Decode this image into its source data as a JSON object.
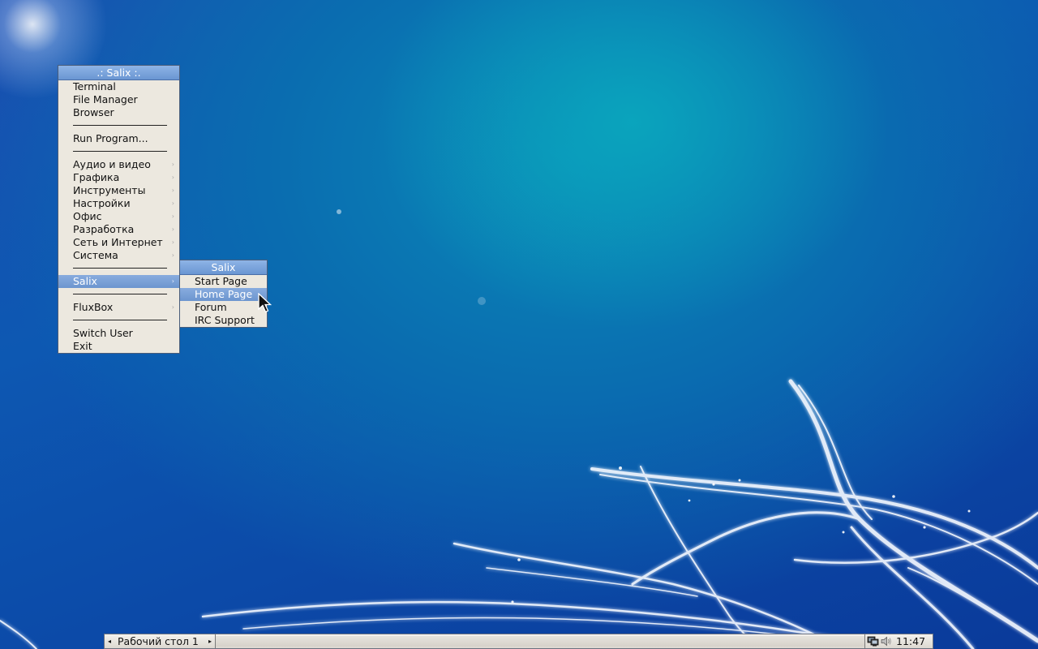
{
  "main_menu": {
    "title": ".: Salix :.",
    "items": {
      "terminal": "Terminal",
      "file_manager": "File Manager",
      "browser": "Browser",
      "run_program": "Run Program...",
      "audio_video": "Аудио и видео",
      "graphics": "Графика",
      "tools": "Инструменты",
      "settings": "Настройки",
      "office": "Офис",
      "development": "Разработка",
      "network": "Сеть и Интернет",
      "system": "Система",
      "salix": "Salix",
      "fluxbox": "FluxBox",
      "switch_user": "Switch User",
      "exit": "Exit"
    },
    "submenu_arrow": "›"
  },
  "salix_submenu": {
    "title": "Salix",
    "items": {
      "start_page": "Start Page",
      "home_page": "Home Page",
      "forum": "Forum",
      "irc_support": "IRC Support"
    }
  },
  "taskbar": {
    "workspace_name": "Рабочий стол 1",
    "prev_arrow": "◂",
    "next_arrow": "▸",
    "clock": "11:47",
    "tray_icons": [
      "network-icon",
      "volume-icon"
    ]
  },
  "colors": {
    "menu_bg": "#ece8df",
    "highlight": "#7aa0d8",
    "desktop_blue": "#0d58b2",
    "desktop_teal": "#0aa0bc"
  }
}
